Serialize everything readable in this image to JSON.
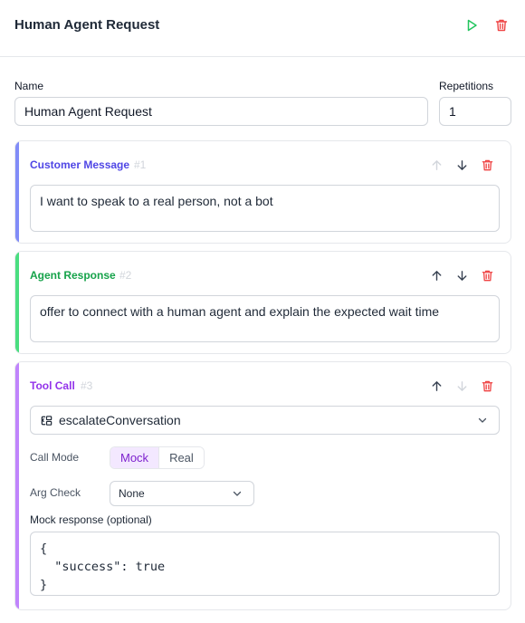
{
  "header": {
    "title": "Human Agent Request",
    "run_icon": "play-icon",
    "delete_icon": "trash-icon"
  },
  "form": {
    "name_label": "Name",
    "name_value": "Human Agent Request",
    "repetitions_label": "Repetitions",
    "repetitions_value": "1"
  },
  "steps": [
    {
      "title": "Customer Message",
      "index": "#1",
      "text": "I want to speak to a real person, not a bot",
      "accent": "#818cf8",
      "title_color": "#4f46e5"
    },
    {
      "title": "Agent Response",
      "index": "#2",
      "text": "offer to connect with a human agent and explain the expected wait time",
      "accent": "#4ade80",
      "title_color": "#16a34a"
    },
    {
      "title": "Tool Call",
      "index": "#3",
      "accent": "#c084fc",
      "title_color": "#9333ea",
      "tool_icon": "tool-icon",
      "tool_name": "escalateConversation",
      "call_mode_label": "Call Mode",
      "call_mode_options": [
        "Mock",
        "Real"
      ],
      "call_mode_selected": "Mock",
      "arg_check_label": "Arg Check",
      "arg_check_value": "None",
      "mock_response_label": "Mock response (optional)",
      "mock_response": "{\n  \"success\": true\n}"
    }
  ],
  "colors": {
    "run": "#22c55e",
    "delete": "#ef4444",
    "arrow_enabled": "#374151",
    "arrow_disabled": "#d1d5db"
  }
}
